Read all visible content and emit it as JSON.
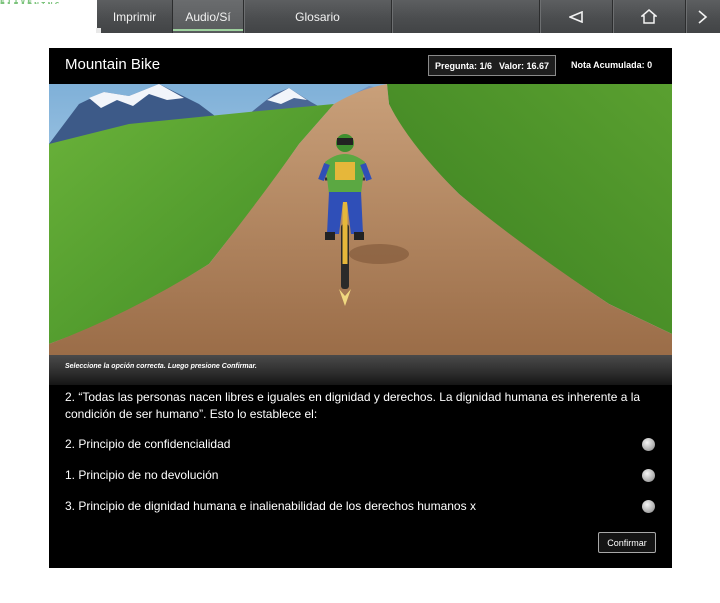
{
  "toolbar": {
    "logo_text": "ETIVE ELEARNING",
    "print_label": "Imprimir",
    "audio_label": "Audio/Sí",
    "glossary_label": "Glosario",
    "icons": [
      "back-triangle-icon",
      "home-icon",
      "exit-icon"
    ]
  },
  "quiz": {
    "title": "Mountain Bike",
    "question_counter": "Pregunta: 1/6",
    "question_value": "Valor: 16.67",
    "accumulated_score": "Nota Acumulada: 0",
    "instruction": "Seleccione la opción correcta. Luego presione Confirmar.",
    "question_text": "2. “Todas las personas nacen libres e iguales en dignidad y derechos. La dignidad humana es inherente a la condición de ser humano”. Esto lo establece el:",
    "options": [
      {
        "label": "2. Principio de confidencialidad",
        "selected": false
      },
      {
        "label": "1. Principio de no devolución",
        "selected": false
      },
      {
        "label": "3. Principio de dignidad humana e inalienabilidad de los derechos humanos x",
        "selected": false
      }
    ],
    "confirm_label": "Confirmar"
  },
  "colors": {
    "toolbar_bg": "#4b4d4f",
    "quiz_bg": "#000000",
    "sky": "#9cc6e8",
    "grass": "#4e9a2e",
    "path": "#a87850"
  }
}
